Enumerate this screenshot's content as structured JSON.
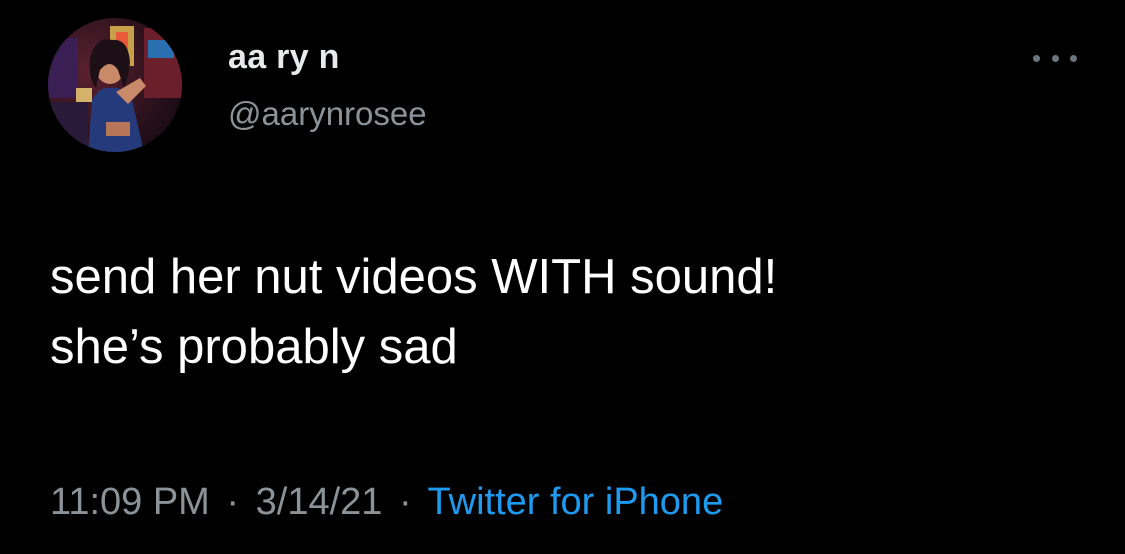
{
  "tweet": {
    "author": {
      "display_name": "aa ry n",
      "handle": "@aarynrosee"
    },
    "menu_icon": "more-horizontal-icon",
    "text": "send her nut videos WITH sound!\nshe’s probably sad",
    "time": "11:09 PM",
    "date": "3/14/21",
    "separator": "·",
    "source": "Twitter for iPhone"
  },
  "colors": {
    "background": "#000000",
    "text": "#ffffff",
    "secondary_text": "#8b9298",
    "link": "#1d9bf0"
  }
}
